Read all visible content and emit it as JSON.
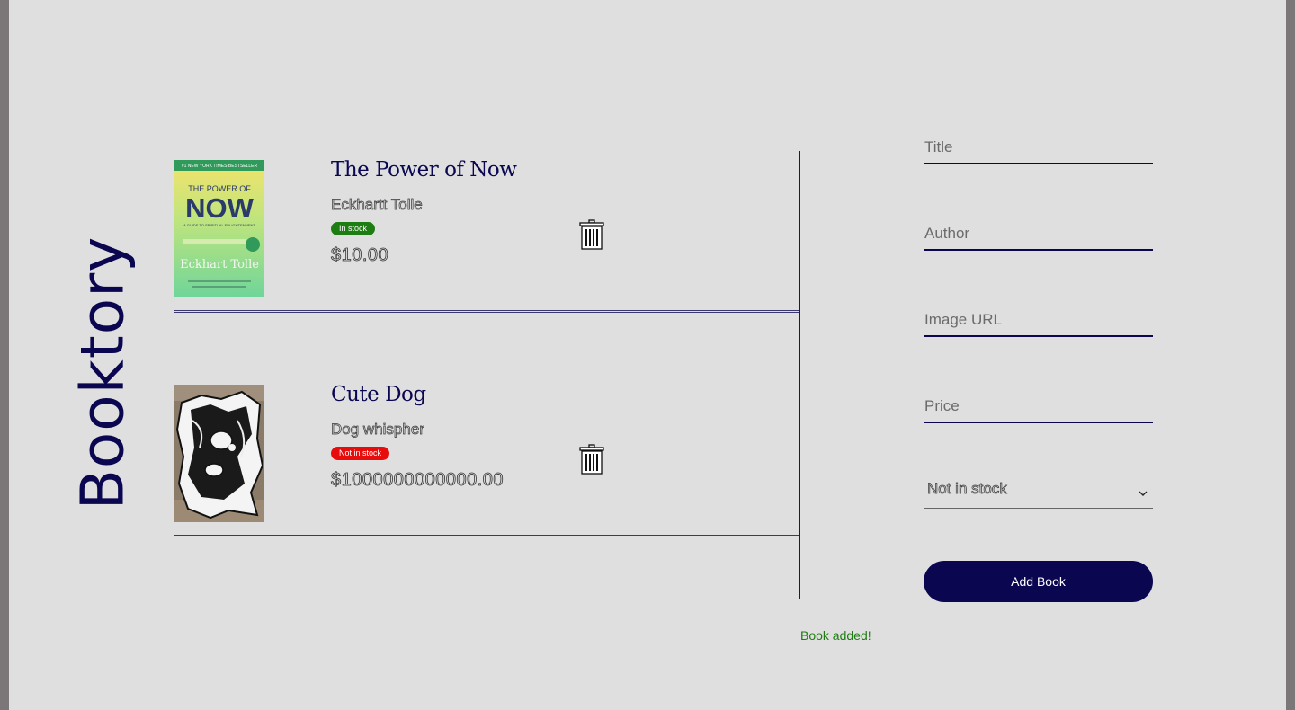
{
  "brand": {
    "title": "Booktory"
  },
  "books": [
    {
      "title": "The Power of Now",
      "author": "Eckhartt Tolle",
      "stock_label": "In stock",
      "price": "$10.00",
      "cover": {
        "banner": "#1 NEW YORK TIMES BESTSELLER",
        "line1": "THE POWER OF",
        "line2": "NOW",
        "subtitle": "A GUIDE TO SPIRITUAL ENLIGHTENMENT",
        "author": "Eckhart Tolle"
      }
    },
    {
      "title": "Cute Dog",
      "author": "Dog whispher",
      "stock_label": "Not in stock",
      "price": "$1000000000000.00"
    }
  ],
  "form": {
    "title_placeholder": "Title",
    "author_placeholder": "Author",
    "image_placeholder": "Image URL",
    "price_placeholder": "Price",
    "stock_selected": "Not in stock",
    "submit_label": "Add Book"
  },
  "status_message": "Book added!",
  "colors": {
    "accent": "#0a0650",
    "in_stock": "#1e7d12",
    "not_in_stock": "#e80d0d",
    "success_text": "#1e7d12"
  },
  "icons": {
    "delete": "trash-icon",
    "select_arrow": "chevron-down-icon"
  }
}
